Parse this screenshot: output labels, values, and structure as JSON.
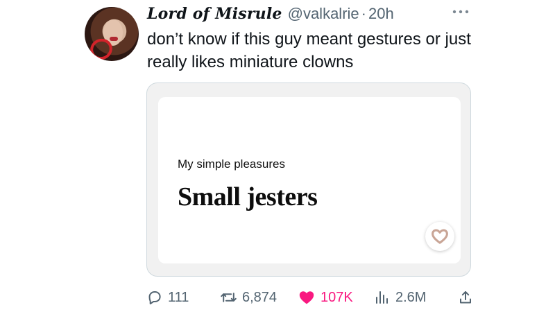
{
  "tweet": {
    "author": {
      "display_name": "Lord of Misrule",
      "handle": "@valkalrie",
      "separator": "·",
      "time": "20h",
      "avatar_icon": "profile-avatar"
    },
    "menu_icon": "more-horizontal-icon",
    "text": "don’t know if this guy meant gestures or just really likes miniature clowns",
    "media_card": {
      "kicker": "My simple pleasures",
      "title": "Small jesters",
      "heart_icon": "heart-outline-icon"
    },
    "actions": {
      "reply_count": "111",
      "repost_count": "6,874",
      "like_count": "107K",
      "view_count": "2.6M",
      "reply_icon": "reply-icon",
      "repost_icon": "repost-icon",
      "like_icon": "heart-filled-icon",
      "views_icon": "analytics-icon",
      "share_icon": "share-icon"
    },
    "colors": {
      "like_pink": "#f91880",
      "muted_gray": "#536471",
      "card_heart": "#c9a596"
    }
  }
}
